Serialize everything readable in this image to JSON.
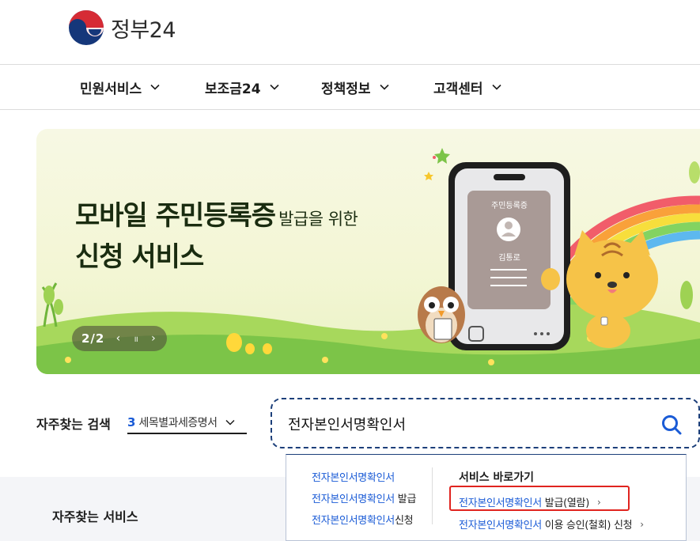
{
  "header": {
    "logo_text": "정부24"
  },
  "nav": {
    "items": [
      {
        "label": "민원서비스"
      },
      {
        "label": "보조금24"
      },
      {
        "label": "정책정보"
      },
      {
        "label": "고객센터"
      }
    ]
  },
  "banner": {
    "title_bold": "모바일 주민등록증",
    "title_small": "발급을 위한",
    "title_line2": "신청 서비스",
    "card_title": "주민등록증",
    "card_name": "김통로",
    "pager_count": "2/2",
    "pager_prev": "‹",
    "pager_pause": "॥",
    "pager_next": "›"
  },
  "search": {
    "fav_label": "자주찾는 검색",
    "fav_num": "3",
    "fav_text": "세목별과세증명서",
    "input_value": "전자본인서명확인서"
  },
  "dropdown": {
    "suggestions": [
      {
        "blue": "전자본인서명확인서",
        "plain": ""
      },
      {
        "blue": "전자본인서명확인서",
        "plain": " 발급"
      },
      {
        "blue": "전자본인서명확인서",
        "plain": "신청"
      }
    ],
    "shortcut_title": "서비스 바로가기",
    "shortcuts": [
      {
        "blue": "전자본인서명확인서",
        "plain": " 발급(열람)",
        "arrow": "›"
      },
      {
        "blue": "전자본인서명확인서",
        "plain": " 이용 승인(철회) 신청",
        "arrow": "›"
      }
    ]
  },
  "fav_services": {
    "title": "자주찾는 서비스"
  },
  "colors": {
    "accent_blue": "#1a5bd6",
    "highlight_red": "#e0241f",
    "nav_border": "#dcdcdc"
  }
}
